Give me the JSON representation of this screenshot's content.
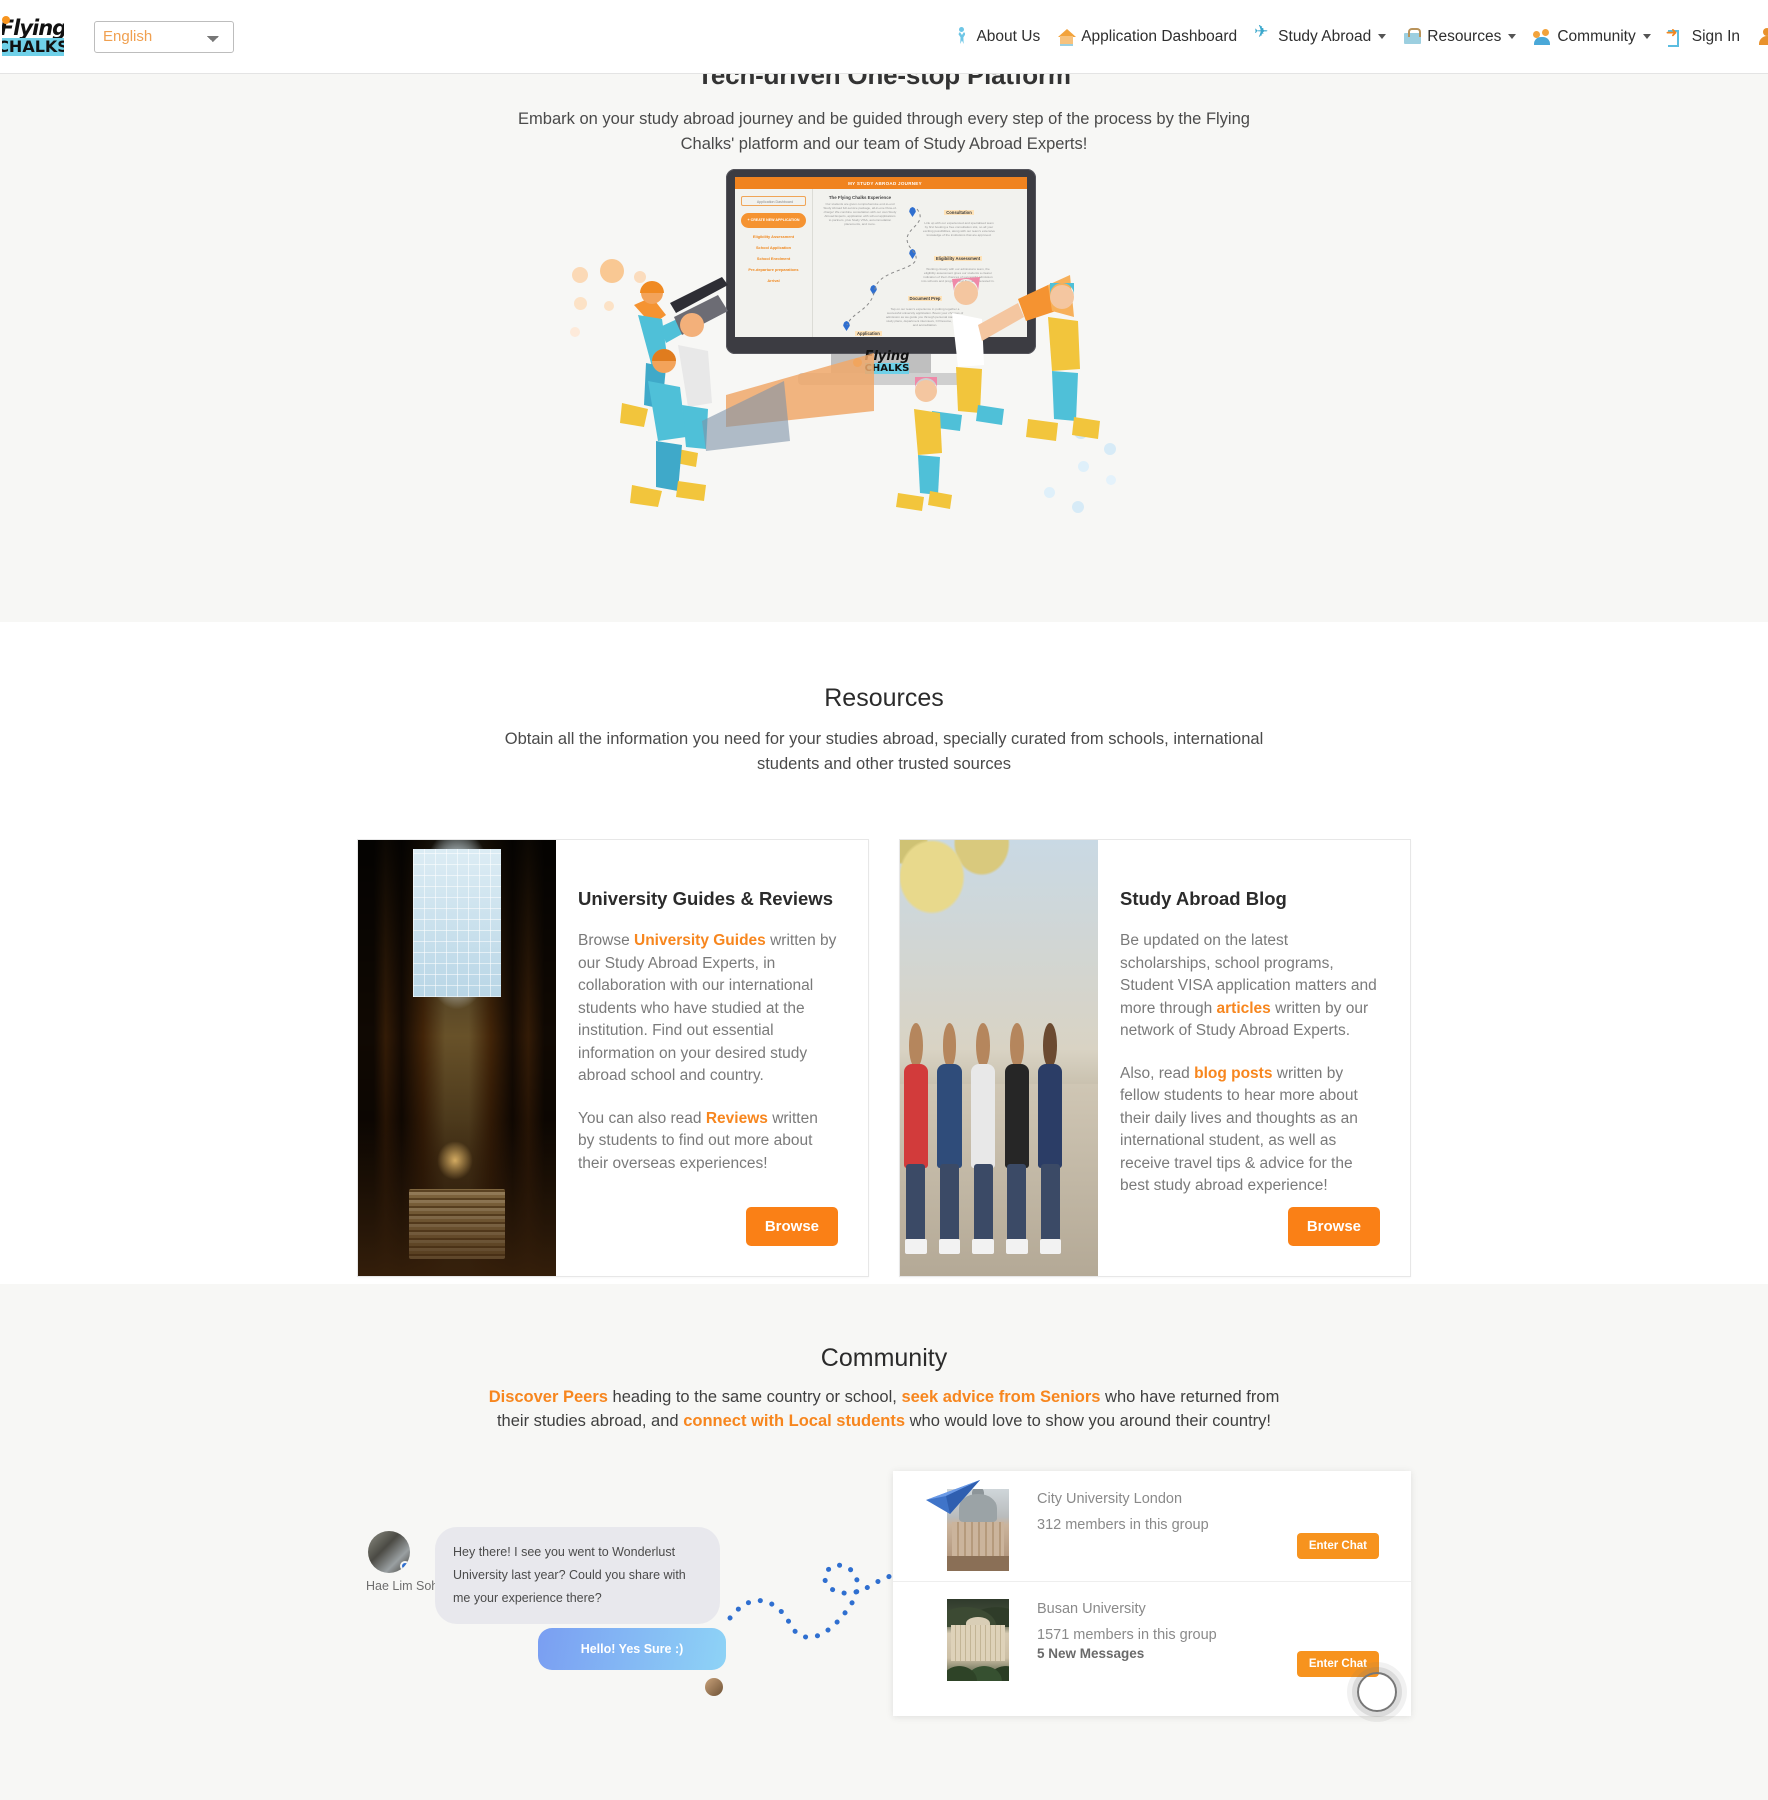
{
  "colors": {
    "accent_orange": "#f7861e",
    "button_orange": "#fa8016",
    "enter_chat_orange": "#f7931e",
    "hero_bg": "#f7f7f5",
    "bubble_in": "#e8e8ed",
    "bubble_out_from": "#7a9ef2",
    "bubble_out_to": "#8ed3f6",
    "path_dot": "#2f6fd0"
  },
  "navbar": {
    "brand": {
      "line1": "Flying",
      "line2": "CHALKS",
      "icon": "flying-chalks-logo"
    },
    "language_select": {
      "value": "English",
      "placeholder": "English",
      "options": [
        "English"
      ],
      "icon": "chevron-down-icon"
    },
    "items": [
      {
        "label": "About Us",
        "icon": "person-icon",
        "has_caret": false
      },
      {
        "label": "Application Dashboard",
        "icon": "home-icon",
        "has_caret": false
      },
      {
        "label": "Study Abroad",
        "icon": "airplane-icon",
        "has_caret": true
      },
      {
        "label": "Resources",
        "icon": "briefcase-icon",
        "has_caret": true
      },
      {
        "label": "Community",
        "icon": "people-group-icon",
        "has_caret": true
      },
      {
        "label": "Sign In",
        "icon": "sign-in-arrow-icon",
        "has_caret": false
      }
    ],
    "avatar": {
      "icon": "user-avatar-icon",
      "label": ""
    }
  },
  "hero": {
    "title": "Tech-driven One-stop Platform",
    "subtitle": "Embark on your study abroad journey and be guided through every step of the process by the Flying Chalks' platform and our team of Study Abroad Experts!",
    "illustration": {
      "name": "study-abroad-platform-illustration",
      "monitor_screen": {
        "topbar": "MY STUDY ABROAD JOURNEY",
        "search_value": "Application Dashboard",
        "cta": "+ CREATE NEW APPLICATION",
        "menu": [
          "Eligibility Assessment",
          "School Application",
          "School Enrolment",
          "Pre-departure preparations",
          "Arrival"
        ],
        "steps": [
          {
            "title": "The Flying Chalks Experience",
            "body": "Our students are given comprehensive end-to-end Study Abroad full-service package, all-in-one Flow-of-charge! We combine consultation with our own Study Abroad Experts, application with school applications to partners, plus Study VISA, accommodation placements, and more."
          },
          {
            "title": "Consultation",
            "body": "Link up with our experienced and specialised team by first booking a free consultation slot, so all your exciting possibilities, along with our team's extensive knowledge of the institutions that are approved."
          },
          {
            "title": "Eligibility Assessment",
            "body": "Working closely with our admissions team, the eligibility assessment gives our students a clearer indication of their chances of successful admission into schools and programs that they are interested in."
          },
          {
            "title": "Document Prep",
            "body": "Tap on our team's experience in putting together a successful university application. Boost your chances of admission as we guide you through personal statements, study plans, department interviews, CV/resume, bursary, and accreditation."
          },
          {
            "title": "Application",
            "body": ""
          }
        ],
        "logo_line1": "Flying",
        "logo_line2": "CHALKS"
      }
    }
  },
  "resources": {
    "title": "Resources",
    "subtitle": "Obtain all the information you need for your studies abroad, specially curated from schools, international students and other trusted sources",
    "cards": [
      {
        "image_name": "library-interior-photo",
        "title": "University Guides & Reviews",
        "paragraphs": [
          [
            {
              "t": "Browse ",
              "link": false
            },
            {
              "t": "University Guides",
              "link": true
            },
            {
              "t": " written by our Study Abroad Experts, in collaboration with our international students who have studied at the institution. Find out essential information on your desired study abroad school and country.",
              "link": false
            }
          ],
          [
            {
              "t": "You can also read ",
              "link": false
            },
            {
              "t": "Reviews",
              "link": true
            },
            {
              "t": " written by students to find out more about their overseas experiences!",
              "link": false
            }
          ]
        ],
        "button": "Browse"
      },
      {
        "image_name": "group-of-students-photo",
        "title": "Study Abroad Blog",
        "paragraphs": [
          [
            {
              "t": "Be updated on the latest scholarships, school programs, Student VISA application matters and more through ",
              "link": false
            },
            {
              "t": "articles",
              "link": true
            },
            {
              "t": " written by our network of Study Abroad Experts.",
              "link": false
            }
          ],
          [
            {
              "t": "Also, read ",
              "link": false
            },
            {
              "t": "blog posts",
              "link": true
            },
            {
              "t": " written by fellow students to hear more about their daily lives and thoughts as an international student, as well as receive travel tips & advice for the best study abroad experience!",
              "link": false
            }
          ]
        ],
        "button": "Browse"
      }
    ]
  },
  "community": {
    "title": "Community",
    "subtitle_parts": [
      {
        "t": "Discover Peers",
        "link": true
      },
      {
        "t": " heading to the same country or school, ",
        "link": false
      },
      {
        "t": "seek advice from Seniors",
        "link": true
      },
      {
        "t": " who have returned from their studies abroad, and ",
        "link": false
      },
      {
        "t": "connect with Local students",
        "link": true
      },
      {
        "t": " who would love to show you around their country!",
        "link": false
      }
    ],
    "chat": {
      "sender_name": "Hae Lim Soh",
      "sender_avatar": "user-photo-avatar",
      "incoming_message": "Hey there! I see you went to Wonderlust University last year? Could you share with me your experience there?",
      "outgoing_message": "Hello! Yes Sure :)",
      "reply_avatar": "small-user-avatar",
      "path": "dotted-path-decoration",
      "plane": "paper-plane-icon"
    },
    "groups": [
      {
        "image_name": "city-university-london-photo",
        "name": "City University London",
        "members": "312 members in this group",
        "new_messages": "",
        "button": "Enter Chat"
      },
      {
        "image_name": "busan-university-photo",
        "name": "Busan University",
        "members": "1571 members in this group",
        "new_messages": "5 New Messages",
        "button": "Enter Chat"
      }
    ],
    "cursor": "mouse-cursor-click-indicator"
  }
}
